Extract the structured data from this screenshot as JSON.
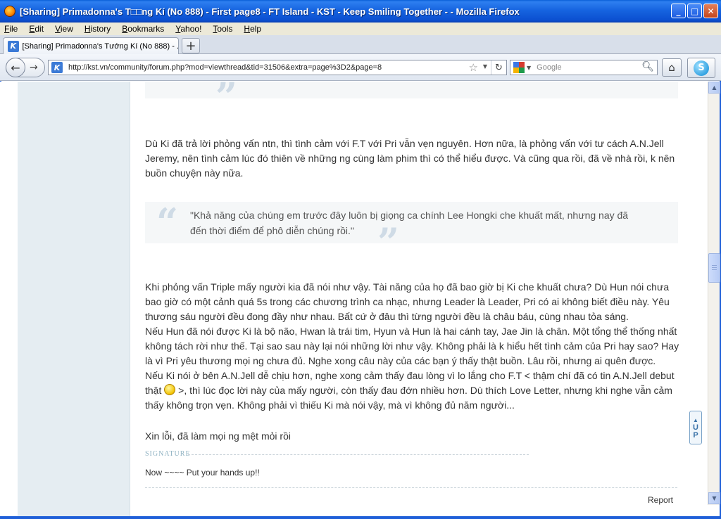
{
  "window": {
    "title": "[Sharing] Primadonna's T□□ng Kí (No 888) - First page8 - FT Island - KST - Keep Smiling Together - - Mozilla Firefox",
    "buttons": {
      "minimize": "_",
      "maximize": "□",
      "close": "✕"
    }
  },
  "menu": [
    {
      "label": "File",
      "hotkey": "F",
      "rest": "ile"
    },
    {
      "label": "Edit",
      "hotkey": "E",
      "rest": "dit"
    },
    {
      "label": "View",
      "hotkey": "V",
      "rest": "iew"
    },
    {
      "label": "History",
      "hotkey": "H",
      "rest": "istory"
    },
    {
      "label": "Bookmarks",
      "hotkey": "B",
      "rest": "ookmarks"
    },
    {
      "label": "Yahoo!",
      "hotkey": "Y",
      "rest": "ahoo!"
    },
    {
      "label": "Tools",
      "hotkey": "T",
      "rest": "ools"
    },
    {
      "label": "Help",
      "hotkey": "H",
      "rest": "elp"
    }
  ],
  "tab": {
    "label": "[Sharing] Primadonna's Tướng Kí (No 888) - ...",
    "new_tab": "+"
  },
  "nav": {
    "back": "←",
    "forward": "→",
    "url": "http://kst.vn/community/forum.php?mod=viewthread&tid=31506&extra=page%3D2&page=8",
    "reload": "↻",
    "star": "☆",
    "search_placeholder": "Google",
    "home": "⌂",
    "addon": "S"
  },
  "post": {
    "quote_close_top": "”",
    "para1": "Dù Ki đã trả lời phỏng vấn ntn, thì tình cảm với F.T với Pri vẫn vẹn nguyên. Hơn nữa, là phỏng vấn với tư cách A.N.Jell Jeremy, nên tình cảm lúc đó thiên về những ng cùng làm phim thì có thể hiểu được. Và cũng qua rồi, đã về nhà rồi, k nên buồn chuyện này nữa.",
    "quote_open": "“",
    "quote": "\"Khả năng của chúng em trước đây luôn bị giọng ca chính Lee Hongki che khuất mất, nhưng nay đã đến thời điểm để phô diễn chúng rồi.\"",
    "quote_close": "”",
    "para2": "Khi phỏng vấn Triple mấy người kia đã nói như vậy. Tài năng của họ đã bao giờ bị Ki che khuất chưa? Dù Hun nói chưa bao giờ có một cảnh quá 5s trong các chương trình ca nhạc, nhưng Leader là Leader, Pri có ai không biết điều này. Yêu thương sáu người đều đong đầy như nhau. Bất cứ ở đâu thì từng người đều là châu báu, cùng nhau tỏa sáng.",
    "para3": "Nếu Hun đã nói được Ki là bộ não, Hwan là trái tim, Hyun và Hun là hai cánh tay, Jae Jin là chân. Một tổng thể thống nhất không tách rời như thế. Tại sao sau này lại nói những lời như vậy. Không phải là k hiểu hết tình cảm của Pri hay sao? Hay là vì Pri yêu thương mọi ng chưa đủ. Nghe xong câu này của các bạn ý thấy thật buồn. Lâu rồi, nhưng ai quên được.",
    "para4a": "Nếu Ki nói ở bên A.N.Jell dễ chịu hơn, nghe xong cảm thấy đau lòng vì lo lắng cho F.T < thậm chí đã có tin A.N.Jell debut thật",
    "para4b": " >, thì lúc đọc lời này của mấy người, còn thấy đau đớn nhiều hơn. Dù thích Love Letter, nhưng khi nghe vẫn cảm thấy không trọn vẹn. Không phải vì thiếu Ki mà nói vậy, mà vì không đủ năm người...",
    "para5": "Xin lỗi, đã làm mọi ng mệt mỏi rồi",
    "signature_label": "SIGNATURE",
    "signature_text": "Now ~~~~ Put your hands up!!",
    "report": "Report"
  },
  "up_button": {
    "arrow": "▲",
    "u": "U",
    "p": "P"
  },
  "scrollbar": {
    "up": "▲",
    "down": "▼"
  },
  "colors": {
    "titlebar": "#1664e0",
    "sidebar": "#e5edf2",
    "quote_bg": "#f5f7f8",
    "signature": "#8fb2c2"
  }
}
